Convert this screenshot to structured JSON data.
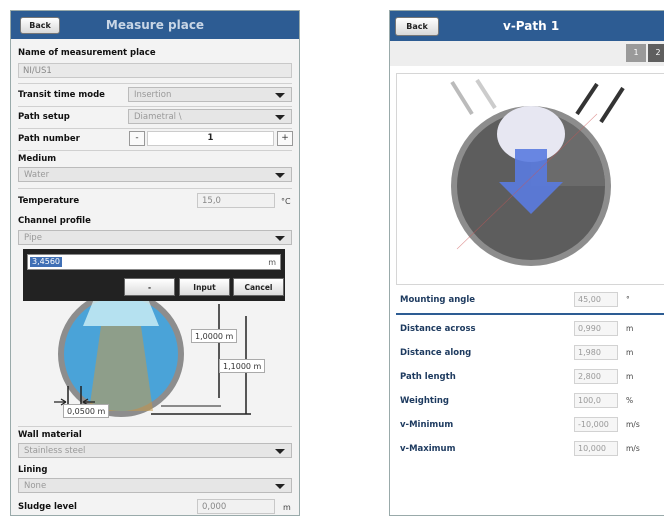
{
  "left": {
    "back_label": "Back",
    "title": "Measure place",
    "name_label": "Name of measurement place",
    "name_value": "NI/US1",
    "transit_label": "Transit time mode",
    "transit_value": "Insertion",
    "path_setup_label": "Path setup",
    "path_setup_value": "Diametral \\",
    "path_number_label": "Path number",
    "path_number_minus": "-",
    "path_number_value": "1",
    "path_number_plus": "+",
    "medium_label": "Medium",
    "medium_value": "Water",
    "temperature_label": "Temperature",
    "temperature_value": "15,0",
    "temperature_unit": "°C",
    "channel_label": "Channel profile",
    "channel_value": "Pipe",
    "popup": {
      "value": "3,4560",
      "unit": "m",
      "minus_label": "-",
      "input_label": "Input",
      "cancel_label": "Cancel"
    },
    "dims": {
      "d1": "1,0000  m",
      "d2": "1,1000  m",
      "d3": "0,0500  m"
    },
    "wall_label": "Wall material",
    "wall_value": "Stainless steel",
    "lining_label": "Lining",
    "lining_value": "None",
    "sludge_label": "Sludge level",
    "sludge_value": "0,000",
    "sludge_unit": "m"
  },
  "right": {
    "back_label": "Back",
    "title": "v-Path 1",
    "tabs": [
      "1",
      "2"
    ],
    "rows": [
      {
        "label": "Mounting angle",
        "value": "45,00",
        "unit": "°"
      },
      {
        "label": "Distance across",
        "value": "0,990",
        "unit": "m"
      },
      {
        "label": "Distance along",
        "value": "1,980",
        "unit": "m"
      },
      {
        "label": "Path length",
        "value": "2,800",
        "unit": "m"
      },
      {
        "label": "Weighting",
        "value": "100,0",
        "unit": "%"
      },
      {
        "label": "v-Minimum",
        "value": "-10,000",
        "unit": "m/s"
      },
      {
        "label": "v-Maximum",
        "value": "10,000",
        "unit": "m/s"
      }
    ]
  },
  "colors": {
    "header": "#2d5c93",
    "accent": "#3f6fb5",
    "pipe_fill": "#4aa3d8",
    "arrow": "#5a7be0"
  },
  "icons": [
    "chevron-down-icon",
    "pipe-diagram-icon",
    "flow-arrow-icon",
    "sensor-rod-icon"
  ]
}
